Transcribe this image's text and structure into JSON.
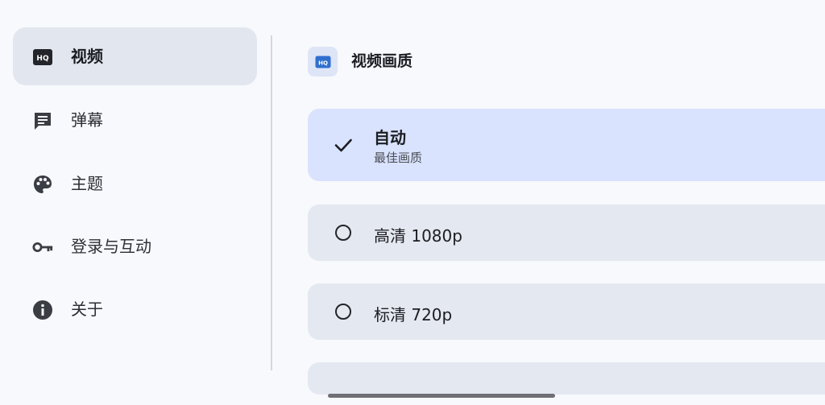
{
  "sidebar": {
    "items": [
      {
        "label": "视频",
        "icon": "hq-video-icon",
        "active": true
      },
      {
        "label": "弹幕",
        "icon": "comment-icon",
        "active": false
      },
      {
        "label": "主题",
        "icon": "palette-icon",
        "active": false
      },
      {
        "label": "登录与互动",
        "icon": "key-icon",
        "active": false
      },
      {
        "label": "关于",
        "icon": "info-icon",
        "active": false
      }
    ]
  },
  "main": {
    "section": {
      "title": "视频画质",
      "icon": "hq-badge-icon"
    },
    "options": [
      {
        "title": "自动",
        "subtitle": "最佳画质",
        "selected": true
      },
      {
        "title": "高清  1080p",
        "selected": false
      },
      {
        "title": "标清  720p",
        "selected": false
      }
    ]
  },
  "colors": {
    "background": "#f8f9fc",
    "active_nav": "#e1e6ef",
    "selected_option": "#d9e3fe",
    "option": "#e4e8f0",
    "accent_icon": "#2f6fcf"
  }
}
